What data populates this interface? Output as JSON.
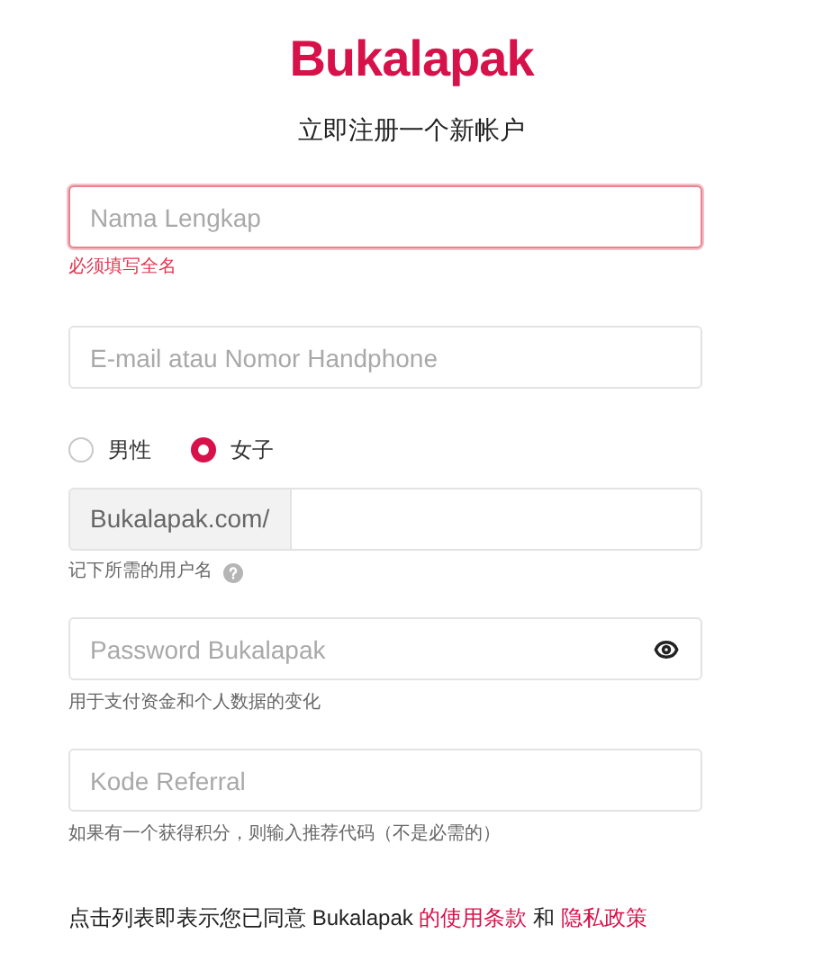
{
  "logo": "Bukalapak",
  "title": "立即注册一个新帐户",
  "name_field": {
    "placeholder": "Nama Lengkap",
    "error": true,
    "error_text": "必须填写全名"
  },
  "contact_field": {
    "placeholder": "E-mail atau Nomor Handphone"
  },
  "gender": [
    {
      "label": "男性",
      "selected": false
    },
    {
      "label": "女子",
      "selected": true
    }
  ],
  "username_field": {
    "prefix": "Bukalapak.com/",
    "hint": "记下所需的用户名"
  },
  "password_field": {
    "placeholder": "Password Bukalapak",
    "hint": "用于支付资金和个人数据的变化"
  },
  "referral_field": {
    "placeholder": "Kode Referral",
    "hint": "如果有一个获得积分，则输入推荐代码（不是必需的）"
  },
  "agreement": {
    "text": "点击列表即表示您已同意 Bukalapak ",
    "terms_link": "的使用条款",
    "joiner": " 和 ",
    "privacy_link": "隐私政策"
  }
}
